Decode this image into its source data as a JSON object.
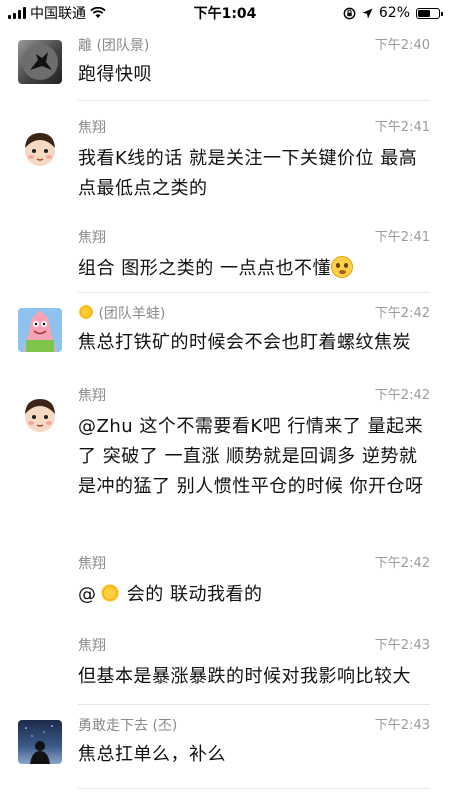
{
  "status_bar": {
    "carrier": "中国联通",
    "time": "下午1:04",
    "battery": "62%",
    "battery_level": 0.62,
    "icons": [
      "signal-icon",
      "wifi-icon",
      "location-lock-icon",
      "location-arrow-icon",
      "battery-icon"
    ]
  },
  "messages": [
    {
      "sender": "離 (团队景)",
      "time": "下午2:40",
      "text": "跑得快呗",
      "avatar": "dark-figure-avatar"
    },
    {
      "sender": "焦翔",
      "time": "下午2:41",
      "text": "我看K线的话  就是关注一下关键价位  最高点最低点之类的",
      "avatar": "cartoon-boy-avatar"
    },
    {
      "sender": "焦翔",
      "time": "下午2:41",
      "text": "组合  图形之类的  一点点也不懂",
      "avatar": ""
    },
    {
      "sender": "(团队羊蛙)",
      "time": "下午2:42",
      "text": "焦总打铁矿的时候会不会也盯着螺纹焦炭",
      "avatar": "patrick-avatar"
    },
    {
      "sender": "焦翔",
      "time": "下午2:42",
      "text": "@Zhu 这个不需要看K吧  行情来了  量起来了  突破了  一直涨  顺势就是回调多  逆势就是冲的猛了  别人惯性平仓的时候  你开仓呀",
      "avatar": "cartoon-boy-avatar"
    },
    {
      "sender": "焦翔",
      "time": "下午2:42",
      "text_prefix": "@",
      "text": "会的  联动我看的",
      "avatar": ""
    },
    {
      "sender": "焦翔",
      "time": "下午2:43",
      "text": "但基本是暴涨暴跌的时候对我影响比较大",
      "avatar": ""
    },
    {
      "sender": "勇敢走下去 (丕)",
      "time": "下午2:43",
      "text": "焦总扛单么，补么",
      "avatar": "night-sky-avatar"
    }
  ],
  "colors": {
    "sender": "#8a8a8a",
    "time": "#9a9a9a",
    "divider": "#e6e6e6",
    "text": "#111111"
  }
}
